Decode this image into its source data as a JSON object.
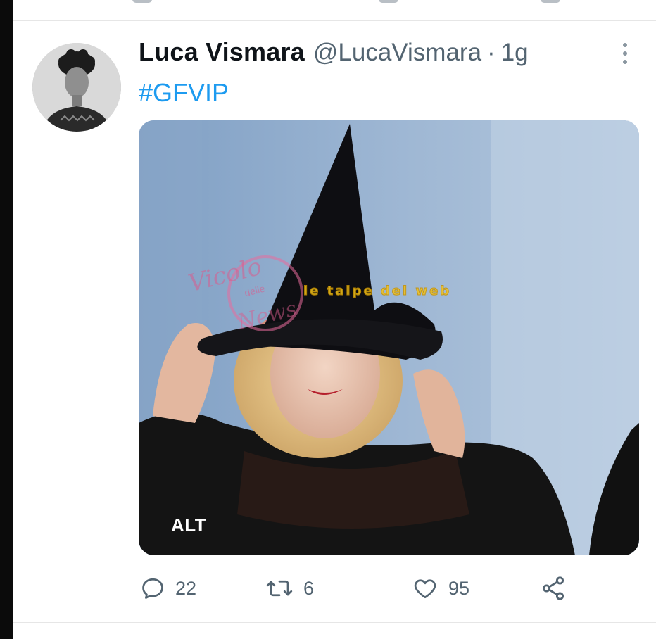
{
  "tweet": {
    "display_name": "Luca Vismara",
    "handle": "@LucaVismara",
    "separator": "·",
    "time": "1g",
    "hashtag": "#GFVIP",
    "media_alt_badge": "ALT",
    "media_watermarks": [
      "Vicolo delle News",
      "le talpe del web"
    ],
    "counts": {
      "replies": "22",
      "retweets": "6",
      "likes": "95"
    }
  },
  "icons": {
    "reply": "reply-bubble-icon",
    "retweet": "retweet-icon",
    "like": "heart-icon",
    "share": "share-icon",
    "more": "more-vertical-icon"
  },
  "colors": {
    "link": "#1d9bf0",
    "secondary_text": "#536471",
    "primary_text": "#0f1419"
  }
}
